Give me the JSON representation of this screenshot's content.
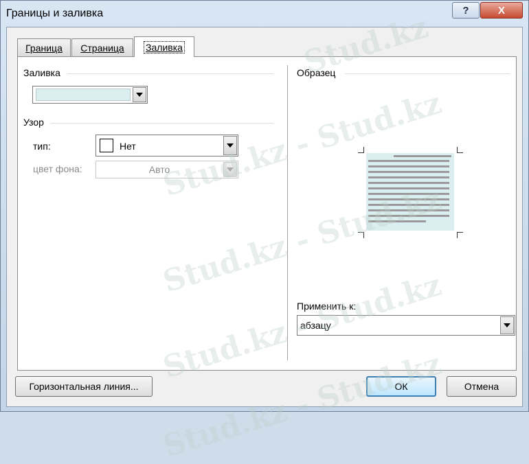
{
  "window": {
    "title": "Границы и заливка",
    "help_label": "?",
    "close_label": "X"
  },
  "tabs": [
    {
      "label": "Граница",
      "active": false
    },
    {
      "label": "Страница",
      "active": false
    },
    {
      "label": "Заливка",
      "active": true
    }
  ],
  "fill": {
    "group_label": "Заливка",
    "color": "#dceff0"
  },
  "pattern": {
    "group_label": "Узор",
    "type_label": "тип:",
    "type_value": "Нет",
    "bg_color_label": "цвет фона:",
    "bg_color_value": "Авто"
  },
  "sample": {
    "group_label": "Образец",
    "fill_color": "#dceff0"
  },
  "apply_to": {
    "label": "Применить к:",
    "value": "абзацу"
  },
  "buttons": {
    "horizontal_line": "Горизонтальная линия...",
    "ok": "ОК",
    "cancel": "Отмена"
  },
  "watermark": {
    "text_1": "Stud.kz",
    "text_2": "Stud.kz - Stud.kz",
    "text_3": "Stud.kz - Stud.kz",
    "text_4": "Stud.kz - Stud.kz",
    "text_5": "Stud.kz - Stud.kz",
    "text_6": "Stud.kz"
  }
}
